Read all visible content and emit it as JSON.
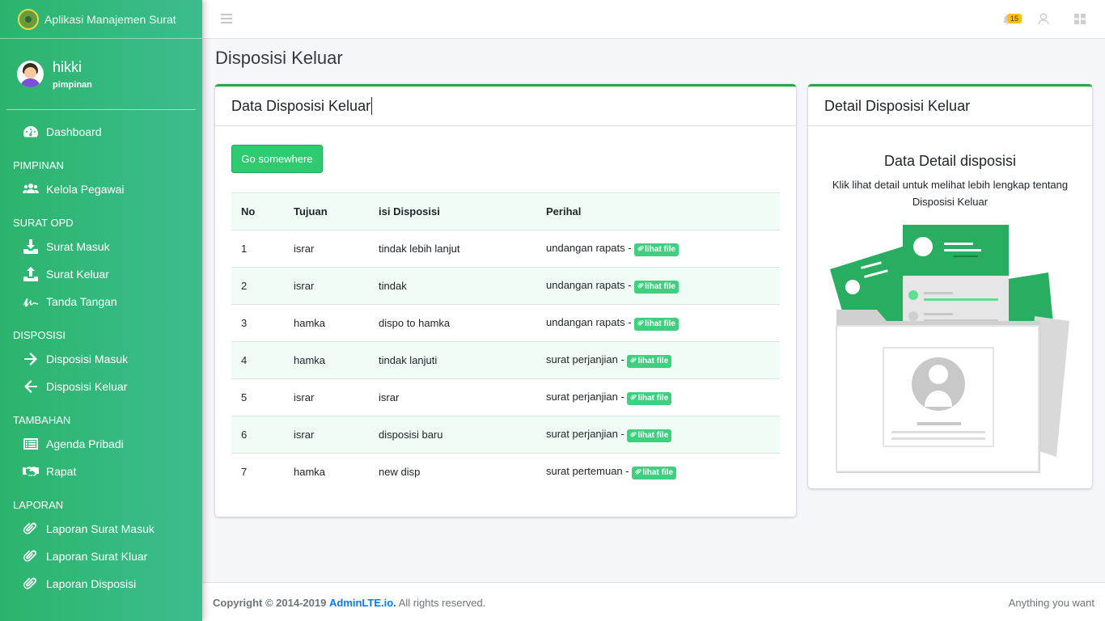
{
  "brand": {
    "title": "Aplikasi Manajemen Surat"
  },
  "user": {
    "name": "hikki",
    "role": "pimpinan"
  },
  "nav": {
    "dashboard": "Dashboard",
    "pimpinan_header": "PIMPINAN",
    "kelola_pegawai": "Kelola Pegawai",
    "surat_header": "SURAT OPD",
    "surat_masuk": "Surat Masuk",
    "surat_keluar": "Surat Keluar",
    "tanda_tangan": "Tanda Tangan",
    "disposisi_header": "DISPOSISI",
    "disposisi_masuk": "Disposisi Masuk",
    "disposisi_keluar": "Disposisi Keluar",
    "tambahan_header": "TAMBAHAN",
    "agenda_pribadi": "Agenda Pribadi",
    "rapat": "Rapat",
    "laporan_header": "LAPORAN",
    "laporan_surat_masuk": "Laporan Surat Masuk",
    "laporan_surat_kluar": "Laporan Surat Kluar",
    "laporan_disposisi": "Laporan Disposisi"
  },
  "topbar": {
    "notification_count": "15"
  },
  "page": {
    "title": "Disposisi Keluar"
  },
  "data_card": {
    "title": "Data Disposisi Keluar",
    "button": "Go somewhere",
    "columns": [
      "No",
      "Tujuan",
      "isi Disposisi",
      "Perihal"
    ],
    "file_label": "lihat file",
    "rows": [
      {
        "no": "1",
        "tujuan": "israr",
        "isi": "tindak lebih lanjut",
        "perihal": "undangan rapats -"
      },
      {
        "no": "2",
        "tujuan": "israr",
        "isi": "tindak",
        "perihal": "undangan rapats -"
      },
      {
        "no": "3",
        "tujuan": "hamka",
        "isi": "dispo to hamka",
        "perihal": "undangan rapats -"
      },
      {
        "no": "4",
        "tujuan": "hamka",
        "isi": "tindak lanjuti",
        "perihal": "surat perjanjian -"
      },
      {
        "no": "5",
        "tujuan": "israr",
        "isi": "israr",
        "perihal": "surat perjanjian -"
      },
      {
        "no": "6",
        "tujuan": "israr",
        "isi": "disposisi baru",
        "perihal": "surat perjanjian -"
      },
      {
        "no": "7",
        "tujuan": "hamka",
        "isi": "new disp",
        "perihal": "surat pertemuan -"
      }
    ]
  },
  "detail_card": {
    "title": "Detail Disposisi Keluar",
    "heading": "Data Detail disposisi",
    "text": "Klik lihat detail untuk melihat lebih lengkap tentang Disposisi Keluar"
  },
  "footer": {
    "copyright": "Copyright © 2014-2019",
    "link": "AdminLTE.io.",
    "rights": "All rights reserved.",
    "right_text": "Anything you want"
  },
  "colors": {
    "accent": "#2cb46c",
    "badge": "#ffc107",
    "table_stripe": "#f0fdf7"
  }
}
